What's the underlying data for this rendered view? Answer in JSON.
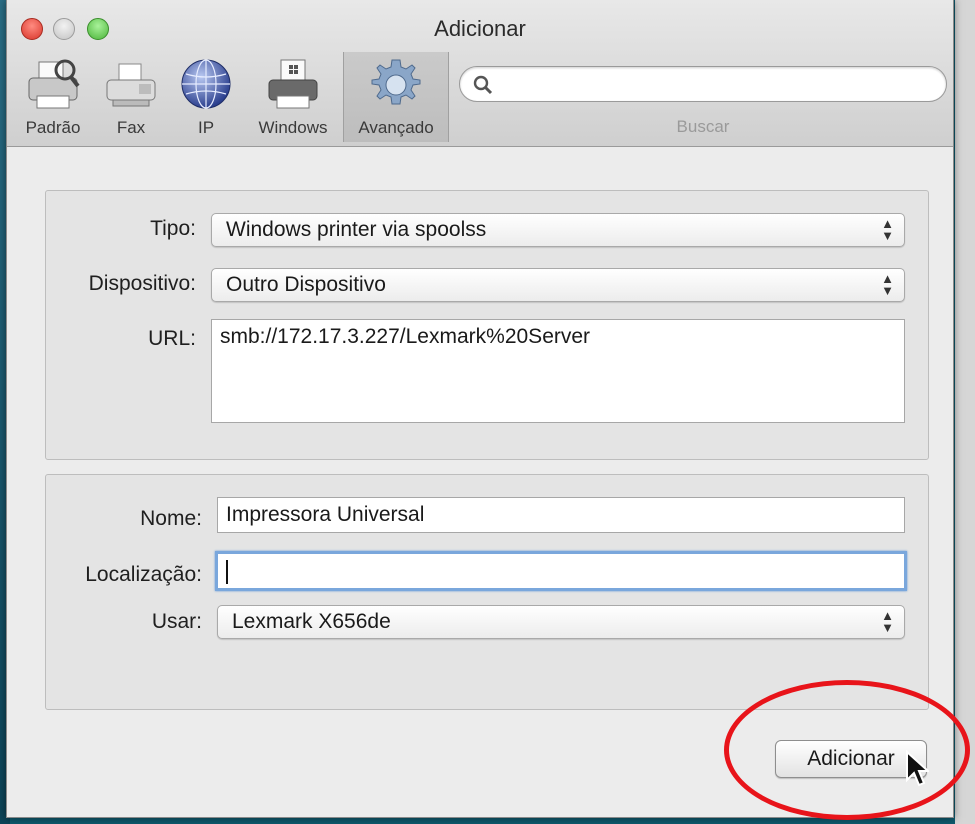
{
  "window": {
    "title": "Adicionar"
  },
  "toolbar": {
    "tabs": [
      {
        "label": "Padrão",
        "icon": "printer-magnifier-icon"
      },
      {
        "label": "Fax",
        "icon": "fax-icon"
      },
      {
        "label": "IP",
        "icon": "globe-icon"
      },
      {
        "label": "Windows",
        "icon": "windows-printer-icon"
      },
      {
        "label": "Avançado",
        "icon": "gear-icon"
      }
    ],
    "selected": "Avançado",
    "search": {
      "value": "",
      "placeholder": "",
      "label": "Buscar"
    }
  },
  "connection": {
    "tipo_label": "Tipo:",
    "tipo_value": "Windows printer via spoolss",
    "dispositivo_label": "Dispositivo:",
    "dispositivo_value": "Outro Dispositivo",
    "url_label": "URL:",
    "url_value": "smb://172.17.3.227/Lexmark%20Server"
  },
  "printer": {
    "nome_label": "Nome:",
    "nome_value": "Impressora Universal",
    "localizacao_label": "Localização:",
    "localizacao_value": "",
    "usar_label": "Usar:",
    "usar_value": "Lexmark X656de"
  },
  "actions": {
    "add_label": "Adicionar"
  },
  "colors": {
    "annotation": "#e8141a",
    "focus": "#7aa7dc"
  }
}
